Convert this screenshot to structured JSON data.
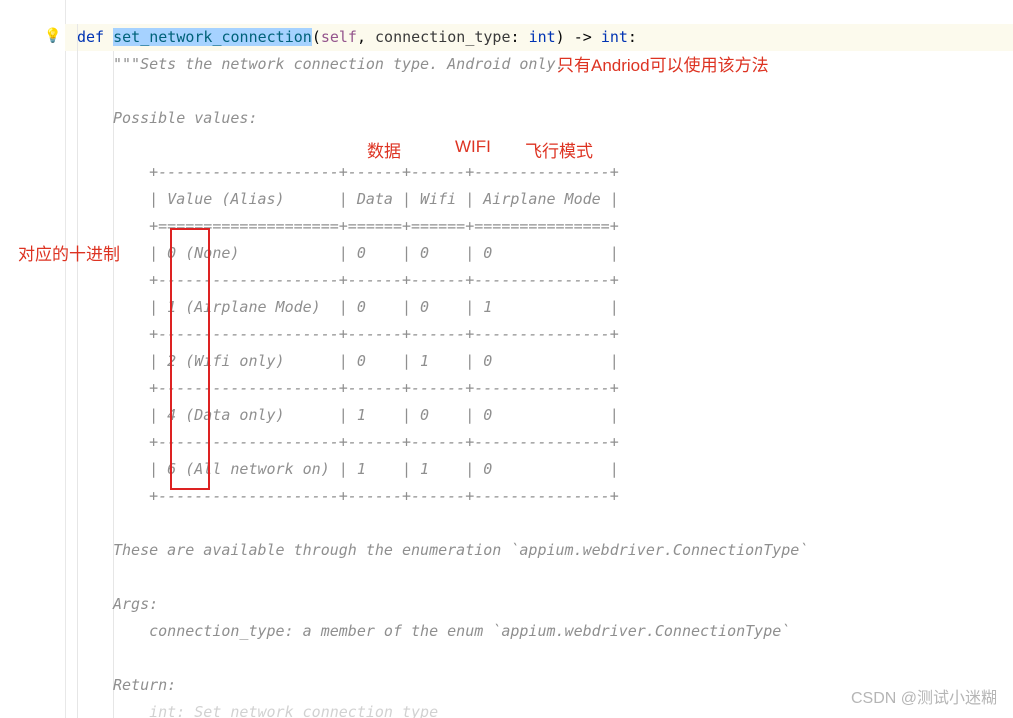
{
  "colors": {
    "annotation": "#dd3322",
    "doc_comment": "#8f8f8f",
    "keyword": "#0033b3",
    "function": "#00627a",
    "self": "#94558D",
    "selection_bg": "#a6d2ff",
    "line_highlight": "#fcfaed"
  },
  "gutter": {
    "bulb_icon": "💡"
  },
  "signature": {
    "keyword": "def ",
    "name": "set_network_connection",
    "open_paren": "(",
    "self": "self",
    "comma": ", ",
    "param": "connection_type",
    "colon_type": ": ",
    "param_type": "int",
    "close_paren": ")",
    "arrow": " -> ",
    "ret_type": "int",
    "end": ":"
  },
  "doc": {
    "line_open": "\"\"\"Sets the network connection type. Android only.",
    "blank": "",
    "possible_values": "Possible values:",
    "table": {
      "border_top": "    +--------------------+------+------+---------------+",
      "header": "    | Value (Alias)      | Data | Wifi | Airplane Mode |",
      "header_sep": "    +====================+======+======+===============+",
      "row0": "    | 0 (None)           | 0    | 0    | 0             |",
      "sep": "    +--------------------+------+------+---------------+",
      "row1": "    | 1 (Airplane Mode)  | 0    | 0    | 1             |",
      "row2": "    | 2 (Wifi only)      | 0    | 1    | 0             |",
      "row4": "    | 4 (Data only)      | 1    | 0    | 0             |",
      "row6": "    | 6 (All network on) | 1    | 1    | 0             |"
    },
    "enum_note": "These are available through the enumeration `appium.webdriver.ConnectionType`",
    "args_label": "Args:",
    "args_desc": "    connection_type: a member of the enum `appium.webdriver.ConnectionType`",
    "return_label": "Return:",
    "return_desc_cut": "    int: Set network connection type"
  },
  "annotations": {
    "android_only": "只有Andriod可以使用该方法",
    "data_col": "数据",
    "wifi_col": "WIFI",
    "airplane_col": "飞行模式",
    "decimal_label": "对应的十进制"
  },
  "watermark": "CSDN @测试小迷糊",
  "chart_data": {
    "type": "table",
    "title": "Possible values",
    "columns": [
      "Value (Alias)",
      "Data",
      "Wifi",
      "Airplane Mode"
    ],
    "rows": [
      {
        "value": 0,
        "alias": "None",
        "data": 0,
        "wifi": 0,
        "airplane_mode": 0
      },
      {
        "value": 1,
        "alias": "Airplane Mode",
        "data": 0,
        "wifi": 0,
        "airplane_mode": 1
      },
      {
        "value": 2,
        "alias": "Wifi only",
        "data": 0,
        "wifi": 1,
        "airplane_mode": 0
      },
      {
        "value": 4,
        "alias": "Data only",
        "data": 1,
        "wifi": 0,
        "airplane_mode": 0
      },
      {
        "value": 6,
        "alias": "All network on",
        "data": 1,
        "wifi": 1,
        "airplane_mode": 0
      }
    ]
  }
}
